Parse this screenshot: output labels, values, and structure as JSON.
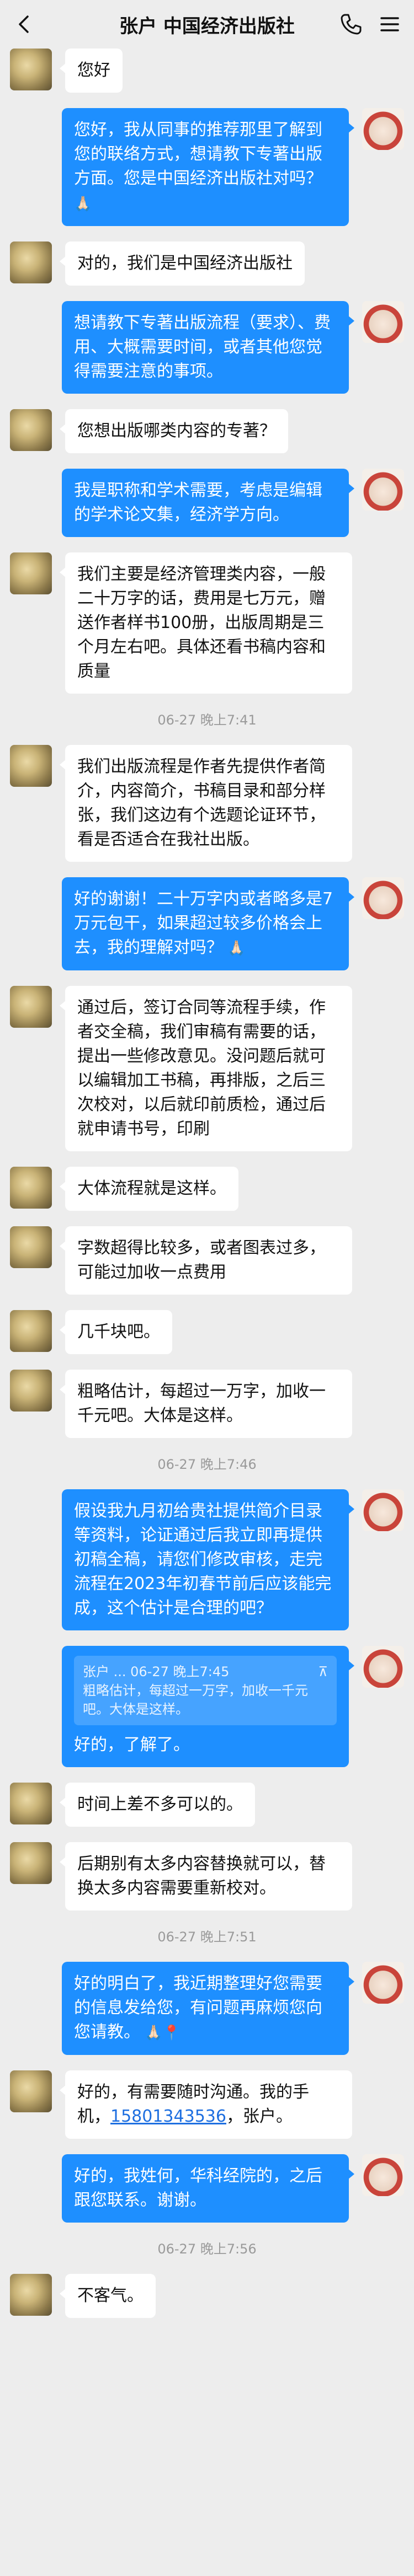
{
  "header": {
    "title": "张户  中国经济出版社",
    "back_icon": "chevron-left-icon",
    "call_icon": "phone-icon",
    "menu_icon": "hamburger-menu-icon"
  },
  "colors": {
    "background": "#EDEDED",
    "my_bubble": "#1E8FFF",
    "their_bubble": "#FFFFFF",
    "link": "#1E6FE0"
  },
  "messages": [
    {
      "from": "them",
      "text": "您好"
    },
    {
      "from": "me",
      "text": "您好，我从同事的推荐那里了解到您的联络方式，想请教下专著出版方面。您是中国经济出版社对吗？",
      "emoji": "🙏🏻"
    },
    {
      "from": "them",
      "text": "对的，我们是中国经济出版社"
    },
    {
      "from": "me",
      "text": "想请教下专著出版流程（要求）、费用、大概需要时间，或者其他您觉得需要注意的事项。"
    },
    {
      "from": "them",
      "text": "您想出版哪类内容的专著？"
    },
    {
      "from": "me",
      "text": "我是职称和学术需要，考虑是编辑的学术论文集，经济学方向。"
    },
    {
      "from": "them",
      "text": "我们主要是经济管理类内容，一般二十万字的话，费用是七万元，赠送作者样书100册，出版周期是三个月左右吧。具体还看书稿内容和质量"
    },
    {
      "time": "06-27 晚上7:41"
    },
    {
      "from": "them",
      "text": "我们出版流程是作者先提供作者简介，内容简介，书稿目录和部分样张，我们这边有个选题论证环节，看是否适合在我社出版。"
    },
    {
      "from": "me",
      "text": "好的谢谢！二十万字内或者略多是7万元包干，如果超过较多价格会上去，我的理解对吗？",
      "emoji": "🙏🏻"
    },
    {
      "from": "them",
      "text": "通过后，签订合同等流程手续，作者交全稿，我们审稿有需要的话，提出一些修改意见。没问题后就可以编辑加工书稿，再排版，之后三次校对，以后就印前质检，通过后就申请书号，印刷"
    },
    {
      "from": "them",
      "text": "大体流程就是这样。"
    },
    {
      "from": "them",
      "text": "字数超得比较多，或者图表过多，可能过加收一点费用"
    },
    {
      "from": "them",
      "text": "几千块吧。"
    },
    {
      "from": "them",
      "text": "粗略估计，每超过一万字，加收一千元吧。大体是这样。"
    },
    {
      "time": "06-27 晚上7:46"
    },
    {
      "from": "me",
      "text": "假设我九月初给贵社提供简介目录等资料，论证通过后我立即再提供初稿全稿，请您们修改审核，走完流程在2023年初春节前后应该能完成，这个估计是合理的吧？"
    },
    {
      "from": "me",
      "quote": {
        "author": "张户",
        "time": "06-27 晚上7:45",
        "text": "粗略估计，每超过一万字，加收一千元吧。大体是这样。"
      },
      "text": "好的，了解了。"
    },
    {
      "from": "them",
      "text": "时间上差不多可以的。"
    },
    {
      "from": "them",
      "text": "后期别有太多内容替换就可以，替换太多内容需要重新校对。"
    },
    {
      "time": "06-27 晚上7:51"
    },
    {
      "from": "me",
      "text": "好的明白了，我近期整理好您需要的信息发给您，有问题再麻烦您向您请教。",
      "emoji": "🙏🏻📍"
    },
    {
      "from": "them",
      "text": "好的，有需要随时沟通。我的手机，",
      "link": "15801343536",
      "text_after": "，张户。"
    },
    {
      "from": "me",
      "text": "好的，我姓何，华科经院的，之后跟您联系。谢谢。"
    },
    {
      "time": "06-27 晚上7:56"
    },
    {
      "from": "them",
      "text": "不客气。"
    }
  ]
}
